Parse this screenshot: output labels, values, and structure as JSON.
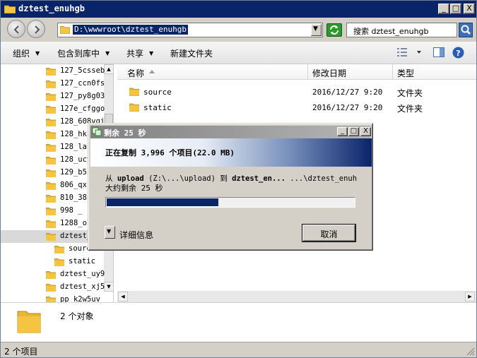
{
  "window": {
    "title": "dztest_enuhgb",
    "min_glyph": "_",
    "max_glyph": "□",
    "close_glyph": "X"
  },
  "address": {
    "path": "D:\\wwwroot\\dztest_enuhgb",
    "search_placeholder": "搜索 dztest_enuhgb"
  },
  "toolbar": {
    "organize": "组织",
    "include_in_library": "包含到库中",
    "share": "共享",
    "new_folder": "新建文件夹"
  },
  "nav": {
    "items": [
      {
        "label": "127_5csseb",
        "indent": 0
      },
      {
        "label": "127_ccn0fs",
        "indent": 0
      },
      {
        "label": "127_py8g03",
        "indent": 0
      },
      {
        "label": "127e_cfggo",
        "indent": 0
      },
      {
        "label": "128_608vgi",
        "indent": 0
      },
      {
        "label": "128_hk",
        "indent": 0
      },
      {
        "label": "128_la",
        "indent": 0
      },
      {
        "label": "128_ucy",
        "indent": 0
      },
      {
        "label": "129_b5",
        "indent": 0
      },
      {
        "label": "806_qx",
        "indent": 0
      },
      {
        "label": "810_38",
        "indent": 0
      },
      {
        "label": "998 _",
        "indent": 0
      },
      {
        "label": "1288_ol",
        "indent": 0
      },
      {
        "label": "dztest_",
        "indent": 0,
        "selected": true
      },
      {
        "label": "source",
        "indent": 1
      },
      {
        "label": "static",
        "indent": 1
      },
      {
        "label": "dztest_uy9",
        "indent": 0
      },
      {
        "label": "dztest_xj5",
        "indent": 0
      },
      {
        "label": "pp_k2w5uv",
        "indent": 0
      }
    ]
  },
  "columns": {
    "name": "名称",
    "modified": "修改日期",
    "type": "类型"
  },
  "files": [
    {
      "name": "source",
      "modified": "2016/12/27 9:20",
      "type": "文件夹"
    },
    {
      "name": "static",
      "modified": "2016/12/27 9:20",
      "type": "文件夹"
    }
  ],
  "details": {
    "count": "2 个对象"
  },
  "status": {
    "text": "2 个项目"
  },
  "dialog": {
    "title": "剩余 25 秒",
    "banner": "正在复制 3,996 个项目(22.0 MB)",
    "from_prefix": "从 ",
    "from_src_name": "upload",
    "from_src_path": " (Z:\\...\\upload) 到 ",
    "from_dst_name": "dztest_en...",
    "from_dst_path": "  ...\\dztest_enuh",
    "remaining": "大约剩余 25 秒",
    "progress": 0.45,
    "details_label": "详细信息",
    "cancel_label": "取消"
  },
  "colors": {
    "title_active": "#0a246a",
    "progress_fill": "#0a246a",
    "folder": "#f5c542"
  }
}
